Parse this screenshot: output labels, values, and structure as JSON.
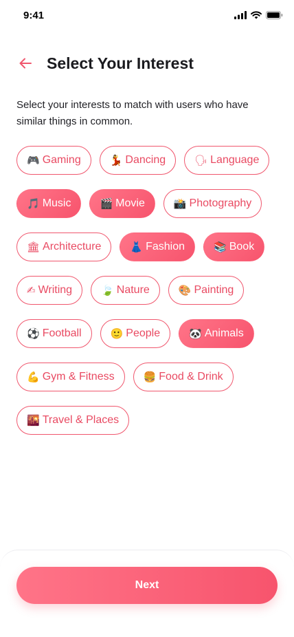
{
  "status_bar": {
    "time": "9:41"
  },
  "header": {
    "title": "Select Your Interest"
  },
  "subtitle": "Select your interests to match with users who have similar things in common.",
  "colors": {
    "accent": "#f7546d",
    "accent_light": "#ff7488"
  },
  "interests": [
    {
      "icon": "🎮",
      "icon_name": "gamepad-icon",
      "label": "Gaming",
      "selected": false
    },
    {
      "icon": "💃",
      "icon_name": "dancer-icon",
      "label": "Dancing",
      "selected": false
    },
    {
      "icon": "🗣",
      "icon_name": "speaking-head-icon",
      "label": "Language",
      "selected": false
    },
    {
      "icon": "🎵",
      "icon_name": "music-note-icon",
      "label": "Music",
      "selected": true
    },
    {
      "icon": "🎬",
      "icon_name": "clapper-board-icon",
      "label": "Movie",
      "selected": true
    },
    {
      "icon": "📸",
      "icon_name": "camera-icon",
      "label": "Photography",
      "selected": false
    },
    {
      "icon": "🏛",
      "icon_name": "classical-building-icon",
      "label": "Architecture",
      "selected": false
    },
    {
      "icon": "👗",
      "icon_name": "dress-icon",
      "label": "Fashion",
      "selected": true
    },
    {
      "icon": "📚",
      "icon_name": "books-icon",
      "label": "Book",
      "selected": true
    },
    {
      "icon": "✍",
      "icon_name": "writing-hand-icon",
      "label": "Writing",
      "selected": false
    },
    {
      "icon": "🍃",
      "icon_name": "leaf-icon",
      "label": "Nature",
      "selected": false
    },
    {
      "icon": "🎨",
      "icon_name": "palette-icon",
      "label": "Painting",
      "selected": false
    },
    {
      "icon": "⚽",
      "icon_name": "soccer-ball-icon",
      "label": "Football",
      "selected": false
    },
    {
      "icon": "🙂",
      "icon_name": "smiling-face-icon",
      "label": "People",
      "selected": false
    },
    {
      "icon": "🐼",
      "icon_name": "panda-icon",
      "label": "Animals",
      "selected": true
    },
    {
      "icon": "💪",
      "icon_name": "flexed-biceps-icon",
      "label": "Gym & Fitness",
      "selected": false
    },
    {
      "icon": "🍔",
      "icon_name": "hamburger-icon",
      "label": "Food & Drink",
      "selected": false
    },
    {
      "icon": "🌇",
      "icon_name": "sunset-city-icon",
      "label": "Travel & Places",
      "selected": false
    }
  ],
  "footer": {
    "next_label": "Next"
  }
}
